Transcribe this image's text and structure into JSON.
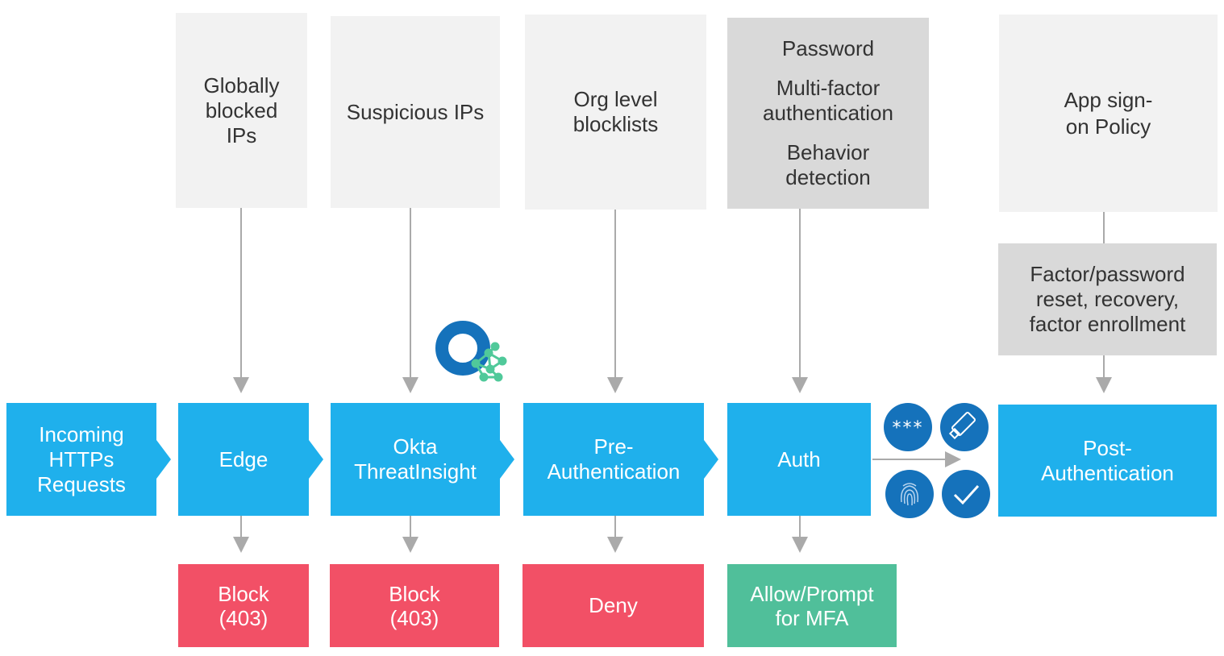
{
  "colors": {
    "stage": "#1fb0ec",
    "block": "#f25066",
    "allow": "#50bf9a",
    "source_light": "#f2f2f2",
    "source_dark": "#d9d9d9",
    "icon": "#1572bb"
  },
  "sources": {
    "global": "Globally blocked IPs",
    "suspicious": "Suspicious IPs",
    "org": "Org level blocklists",
    "auth": [
      "Password",
      "Multi-factor authentication",
      "Behavior detection"
    ],
    "app": "App sign-on Policy",
    "factor": "Factor/password reset, recovery, factor enrollment"
  },
  "stages": {
    "incoming": "Incoming HTTPs Requests",
    "edge": "Edge",
    "threatinsight": "Okta ThreatInsight",
    "preauth": "Pre-Authentication",
    "auth": "Auth",
    "postauth": "Post-Authentication"
  },
  "outcomes": {
    "edge": "Block (403)",
    "threatinsight": "Block (403)",
    "preauth": "Deny",
    "auth": "Allow/Prompt for MFA"
  },
  "icons": [
    "password-icon",
    "security-key-icon",
    "fingerprint-icon",
    "checkmark-icon",
    "threatinsight-logo"
  ]
}
